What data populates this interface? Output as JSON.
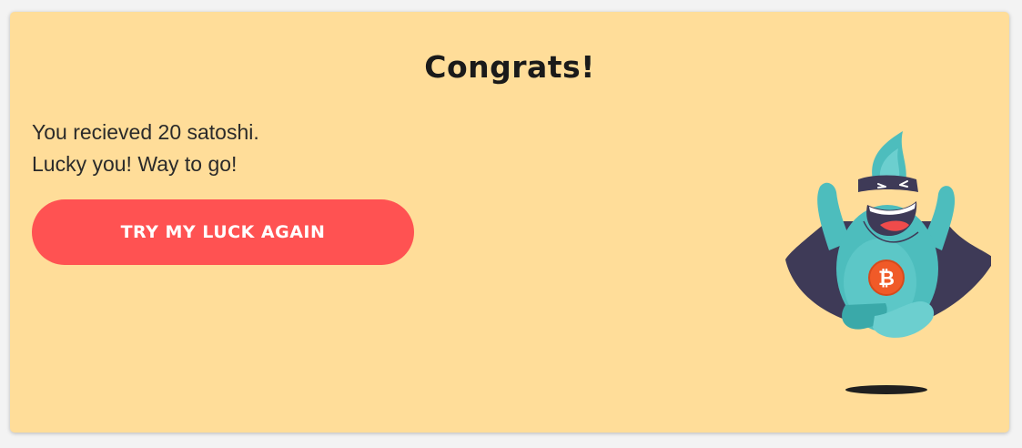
{
  "dialog": {
    "title": "Congrats!",
    "message_line1": "You recieved 20 satoshi.",
    "message_line2": "Lucky you! Way to go!",
    "button_label": "TRY MY LUCK AGAIN"
  },
  "mascot": {
    "icon": "bitcoin-mascot-icon",
    "medallion_icon": "bitcoin-icon"
  },
  "colors": {
    "card_background": "#ffdd99",
    "button": "#ff5252",
    "mascot_body": "#4dbdbd",
    "cape": "#3e3a57",
    "medallion": "#f05a28"
  }
}
